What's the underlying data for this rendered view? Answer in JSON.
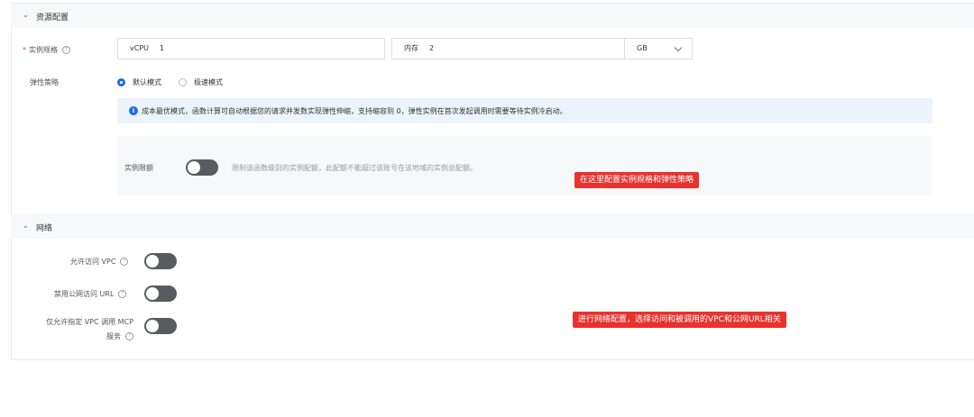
{
  "resource": {
    "title": "资源配置",
    "spec_label": "实例规格",
    "vcpu_prefix": "vCPU",
    "vcpu_value": "1",
    "mem_prefix": "内存",
    "mem_value": "2",
    "mem_unit": "GB",
    "elastic_label": "弹性策略",
    "mode_default": "默认模式",
    "mode_fast": "极速模式",
    "selected_mode": "默认模式",
    "info_text": "成本最优模式，函数计算可自动根据您的请求并发数实现弹性伸缩，支持缩容到 0，弹性实例在首次发起调用时需要等待实例冷启动。",
    "quota_label": "实例限额",
    "quota_hint": "限制该函数级别的实例配额，此配额不能超过该账号在该地域的实例总配额。"
  },
  "network": {
    "title": "网络",
    "vpc_label": "允许访问 VPC",
    "public_url_label": "禁用公网访问 URL",
    "mcp_label_line1": "仅允许指定 VPC 调用 MCP",
    "mcp_label_line2": "服务"
  },
  "annotations": {
    "callout_resource": "在这里配置实例规格和弹性策略",
    "callout_network": "进行网络配置，选择访问和被调用的VPC和公网URL相关"
  },
  "colors": {
    "accent": "#1a6ee8",
    "callout": "#e8322e",
    "toggle_off": "#595b61"
  }
}
